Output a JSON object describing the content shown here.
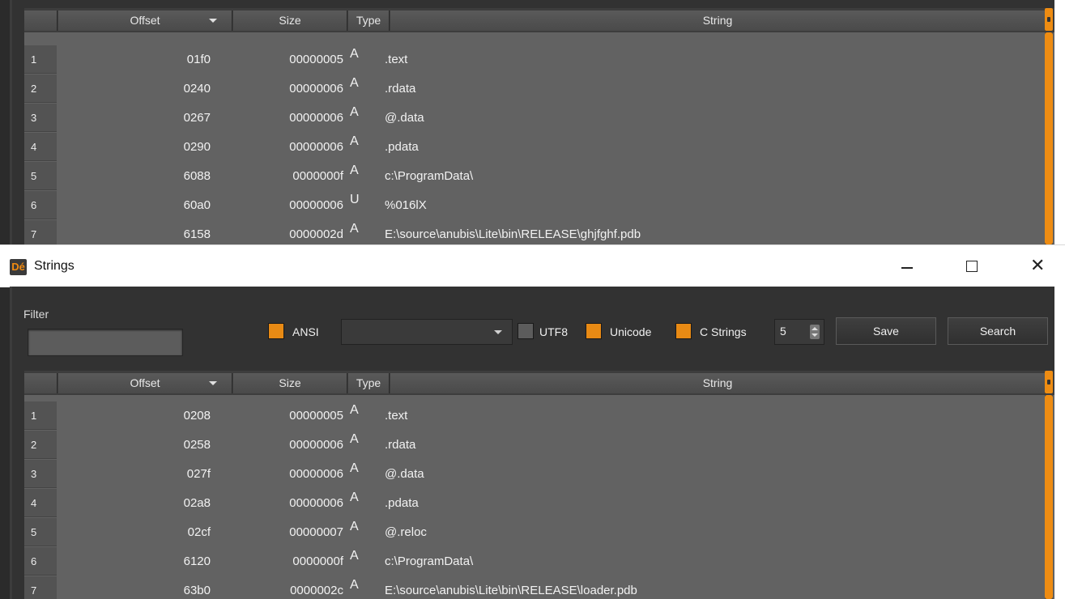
{
  "window": {
    "title": "Strings",
    "icon": "app-logo-icon"
  },
  "columns": {
    "offset": "Offset",
    "size": "Size",
    "type": "Type",
    "string": "String"
  },
  "background_table": {
    "rows": [
      {
        "n": "1",
        "offset": "01f0",
        "size": "00000005",
        "type": "A",
        "string": ".text"
      },
      {
        "n": "2",
        "offset": "0240",
        "size": "00000006",
        "type": "A",
        "string": ".rdata"
      },
      {
        "n": "3",
        "offset": "0267",
        "size": "00000006",
        "type": "A",
        "string": "@.data"
      },
      {
        "n": "4",
        "offset": "0290",
        "size": "00000006",
        "type": "A",
        "string": ".pdata"
      },
      {
        "n": "5",
        "offset": "6088",
        "size": "0000000f",
        "type": "A",
        "string": "c:\\ProgramData\\"
      },
      {
        "n": "6",
        "offset": "60a0",
        "size": "00000006",
        "type": "U",
        "string": "%016lX"
      },
      {
        "n": "7",
        "offset": "6158",
        "size": "0000002d",
        "type": "A",
        "string": "E:\\source\\anubis\\Lite\\bin\\RELEASE\\ghjfghf.pdb"
      }
    ]
  },
  "toolbar": {
    "filter_label": "Filter",
    "filter_value": "",
    "ansi_label": "ANSI",
    "ansi_checked": true,
    "encoding_value": "",
    "utf8_label": "UTF8",
    "utf8_checked": false,
    "unicode_label": "Unicode",
    "unicode_checked": true,
    "cstrings_label": "C Strings",
    "cstrings_checked": true,
    "min_length": "5",
    "save_label": "Save",
    "search_label": "Search"
  },
  "table": {
    "rows": [
      {
        "n": "1",
        "offset": "0208",
        "size": "00000005",
        "type": "A",
        "string": ".text"
      },
      {
        "n": "2",
        "offset": "0258",
        "size": "00000006",
        "type": "A",
        "string": ".rdata"
      },
      {
        "n": "3",
        "offset": "027f",
        "size": "00000006",
        "type": "A",
        "string": "@.data"
      },
      {
        "n": "4",
        "offset": "02a8",
        "size": "00000006",
        "type": "A",
        "string": ".pdata"
      },
      {
        "n": "5",
        "offset": "02cf",
        "size": "00000007",
        "type": "A",
        "string": "@.reloc"
      },
      {
        "n": "6",
        "offset": "6120",
        "size": "0000000f",
        "type": "A",
        "string": "c:\\ProgramData\\"
      },
      {
        "n": "7",
        "offset": "63b0",
        "size": "0000002c",
        "type": "A",
        "string": "E:\\source\\anubis\\Lite\\bin\\RELEASE\\loader.pdb"
      }
    ]
  },
  "colors": {
    "accent": "#ee8c12",
    "panel": "#323232",
    "table": "#626262"
  }
}
